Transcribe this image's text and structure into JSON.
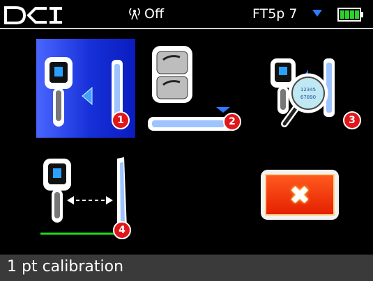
{
  "status_bar": {
    "logo_text": "DCI",
    "signal_label": "Off",
    "mode_label": "FT5p 7",
    "icons": {
      "signal": "antenna-signal-icon",
      "frequency": "down-triangle-icon",
      "battery": "battery-icon"
    },
    "battery_level": 1.0,
    "colors": {
      "accent_blue": "#2e7bff",
      "battery_green": "#2bd22b"
    }
  },
  "tiles": [
    {
      "badge": "1",
      "icon": "transmitter-locator-calibration-icon",
      "selected": true
    },
    {
      "badge": "2",
      "icon": "above-ground-range-icon",
      "selected": false
    },
    {
      "badge": "3",
      "icon": "transmitter-info-search-icon",
      "selected": false,
      "magnifier_lines": [
        "12345",
        "67890"
      ]
    },
    {
      "badge": "4",
      "icon": "distance-calibration-icon",
      "selected": false
    }
  ],
  "cancel": {
    "icon": "close-x-icon",
    "symbol": "✖"
  },
  "bottom_label": "1 pt calibration",
  "colors": {
    "highlight_blue": "#1630d8",
    "badge_red": "#e0171a",
    "cancel_orange": "#ff4a10"
  }
}
